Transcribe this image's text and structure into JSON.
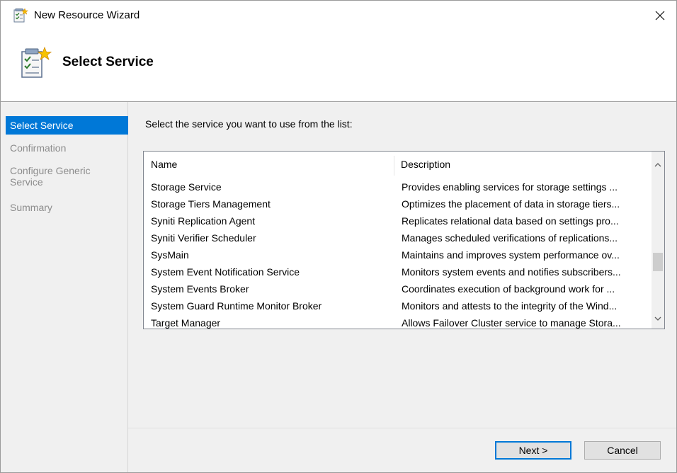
{
  "window": {
    "title": "New Resource Wizard"
  },
  "header": {
    "title": "Select Service"
  },
  "sidebar": {
    "steps": [
      {
        "label": "Select Service",
        "state": "active"
      },
      {
        "label": "Confirmation",
        "state": "inactive"
      },
      {
        "label": "Configure Generic Service",
        "state": "inactive"
      },
      {
        "label": "Summary",
        "state": "inactive"
      }
    ]
  },
  "main": {
    "instruction": "Select the service you want to use from the list:",
    "columns": {
      "name": "Name",
      "description": "Description"
    },
    "rows": [
      {
        "name": "Storage Service",
        "description": "Provides enabling services for storage settings ..."
      },
      {
        "name": "Storage Tiers Management",
        "description": "Optimizes the placement of data in storage tiers..."
      },
      {
        "name": "Syniti Replication Agent",
        "description": "Replicates relational data based on settings pro..."
      },
      {
        "name": "Syniti Verifier Scheduler",
        "description": "Manages scheduled verifications of replications..."
      },
      {
        "name": "SysMain",
        "description": "Maintains and improves system performance ov..."
      },
      {
        "name": "System Event Notification Service",
        "description": "Monitors system events and notifies subscribers..."
      },
      {
        "name": "System Events Broker",
        "description": "Coordinates execution of background work for ..."
      },
      {
        "name": "System Guard Runtime Monitor Broker",
        "description": "Monitors and attests to the integrity of the Wind..."
      },
      {
        "name": "Target Manager",
        "description": "Allows Failover Cluster service to manage Stora..."
      }
    ]
  },
  "buttons": {
    "next": "Next >",
    "cancel": "Cancel"
  },
  "colors": {
    "accent": "#0078d7",
    "panel": "#f0f0f0",
    "disabled_text": "#8c8c8c"
  },
  "icons": {
    "title": "wizard-icon",
    "header": "wizard-checklist-icon",
    "close": "close-icon"
  }
}
